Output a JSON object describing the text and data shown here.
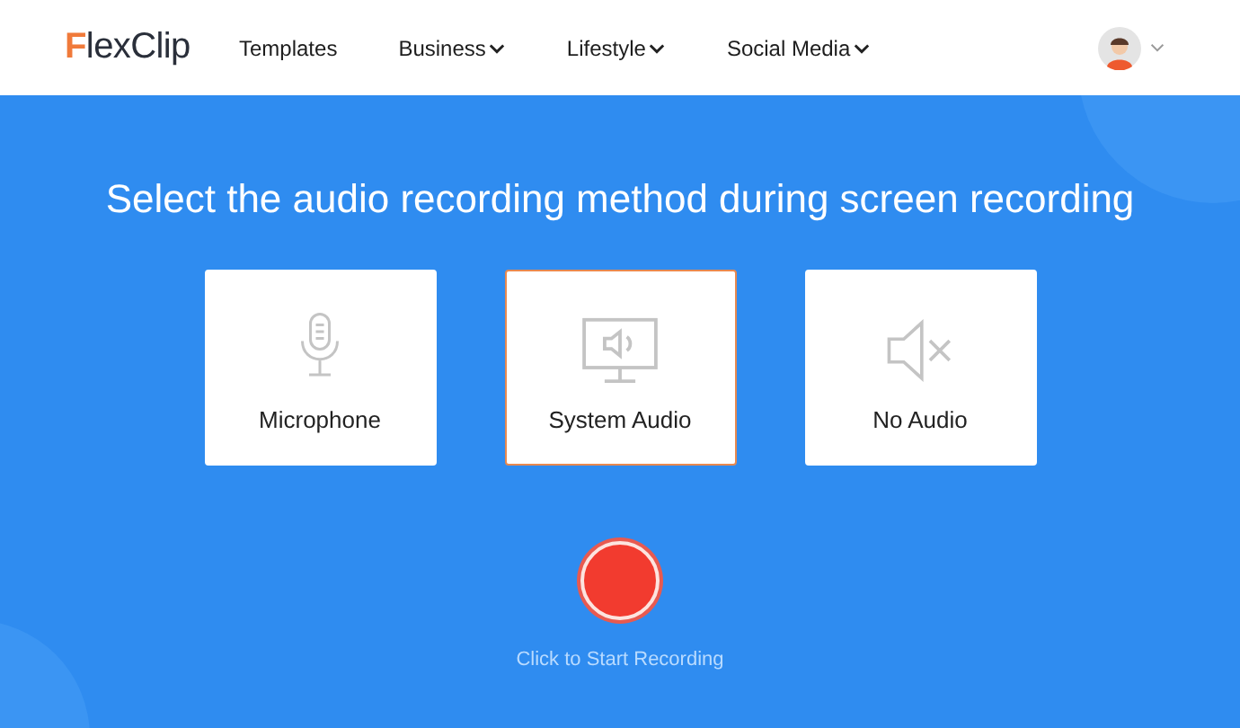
{
  "header": {
    "logo": {
      "mark": "F",
      "rest": "lexClip"
    },
    "nav": [
      {
        "label": "Templates",
        "has_menu": false
      },
      {
        "label": "Business",
        "has_menu": true
      },
      {
        "label": "Lifestyle",
        "has_menu": true
      },
      {
        "label": "Social Media",
        "has_menu": true
      }
    ],
    "account_menu": true
  },
  "title": "Select the audio recording method during screen recording",
  "options": [
    {
      "kind": "microphone",
      "label": "Microphone",
      "selected": false
    },
    {
      "kind": "system",
      "label": "System Audio",
      "selected": true
    },
    {
      "kind": "none",
      "label": "No Audio",
      "selected": false
    }
  ],
  "record": {
    "hint": "Click to Start Recording"
  }
}
